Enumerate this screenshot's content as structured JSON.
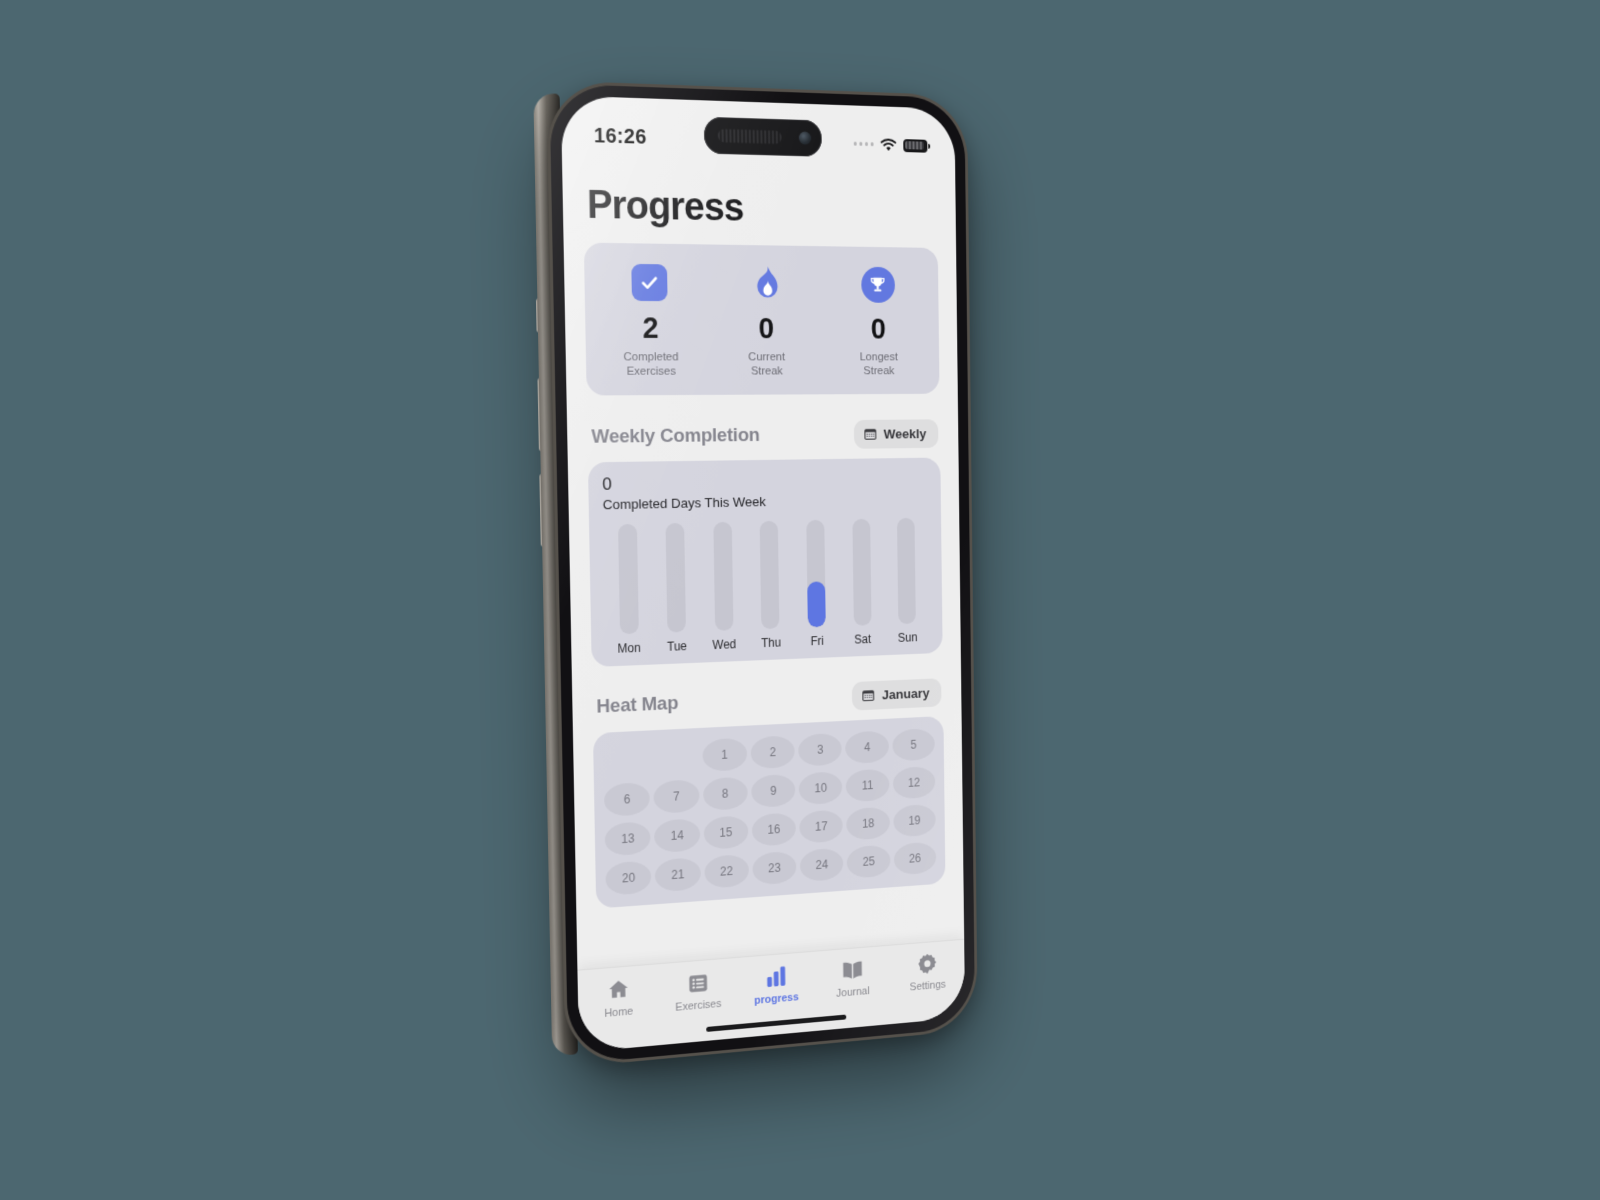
{
  "theme": {
    "accent": "#5e76e2",
    "backdrop": "#4c6770",
    "screen_bg": "#eeeeee",
    "card_bg": "#d4d4de"
  },
  "status_bar": {
    "time": "16:26",
    "wifi_icon": "wifi-icon",
    "battery_icon": "battery-icon",
    "cellular_icon": "cellular-dots-icon"
  },
  "header": {
    "title": "Progress"
  },
  "stats": [
    {
      "icon": "check-square-icon",
      "icon_style": "rounded-square",
      "value": "2",
      "label": "Completed\nExercises",
      "label_line1": "Completed",
      "label_line2": "Exercises"
    },
    {
      "icon": "flame-icon",
      "icon_style": "glyph",
      "value": "0",
      "label": "Current\nStreak",
      "label_line1": "Current",
      "label_line2": "Streak"
    },
    {
      "icon": "trophy-icon",
      "icon_style": "circle",
      "value": "0",
      "label": "Longest\nStreak",
      "label_line1": "Longest",
      "label_line2": "Streak"
    }
  ],
  "weekly": {
    "section_title": "Weekly Completion",
    "filter_label": "Weekly",
    "filter_icon": "calendar-icon",
    "count": "0",
    "caption": "Completed Days This Week"
  },
  "chart_data": {
    "type": "bar",
    "title": "Weekly Completion",
    "subtitle": "Completed Days This Week",
    "categories": [
      "Mon",
      "Tue",
      "Wed",
      "Thu",
      "Fri",
      "Sat",
      "Sun"
    ],
    "values": [
      0,
      0,
      0,
      0,
      0.42,
      0,
      0
    ],
    "value_unit": "fraction-of-track",
    "highlight_category": "Fri",
    "xlabel": "",
    "ylabel": "",
    "ylim": [
      0,
      1
    ],
    "grid": false,
    "legend": "none",
    "bar_track_color": "#c6c6d0",
    "bar_fill_color": "#5e76e2"
  },
  "heatmap": {
    "section_title": "Heat Map",
    "filter_label": "January",
    "filter_icon": "calendar-icon",
    "leading_blanks": 2,
    "days": [
      "1",
      "2",
      "3",
      "4",
      "5",
      "6",
      "7",
      "8",
      "9",
      "10",
      "11",
      "12",
      "13",
      "14",
      "15",
      "16",
      "17",
      "18",
      "19",
      "20",
      "21",
      "22",
      "23",
      "24",
      "25",
      "26"
    ]
  },
  "tabbar": {
    "items": [
      {
        "label": "Home",
        "icon": "home-icon",
        "active": false
      },
      {
        "label": "Exercises",
        "icon": "list-icon",
        "active": false
      },
      {
        "label": "progress",
        "icon": "bar-chart-icon",
        "active": true
      },
      {
        "label": "Journal",
        "icon": "book-icon",
        "active": false
      },
      {
        "label": "Settings",
        "icon": "gear-icon",
        "active": false
      }
    ]
  }
}
